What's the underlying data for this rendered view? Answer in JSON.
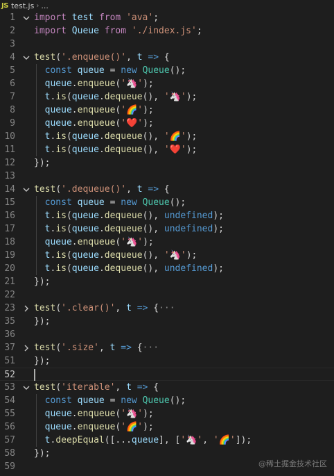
{
  "breadcrumb": {
    "lang_badge": "JS",
    "file": "test.js",
    "separator": "›",
    "more": "..."
  },
  "colors": {
    "background": "#1e1e1e",
    "keyword": "#c586c0",
    "builtin": "#569cd6",
    "string": "#ce9178",
    "function": "#dcdcaa",
    "variable": "#9cdcfe",
    "class": "#4ec9b0",
    "line_number": "#858585"
  },
  "lines": [
    {
      "n": "1",
      "fold": "open",
      "tokens": [
        [
          "kw",
          "import"
        ],
        [
          "pl",
          " "
        ],
        [
          "var",
          "test"
        ],
        [
          "pl",
          " "
        ],
        [
          "kw",
          "from"
        ],
        [
          "pl",
          " "
        ],
        [
          "str",
          "'ava'"
        ],
        [
          "pl",
          ";"
        ]
      ]
    },
    {
      "n": "2",
      "tokens": [
        [
          "kw",
          "import"
        ],
        [
          "pl",
          " "
        ],
        [
          "var",
          "Queue"
        ],
        [
          "pl",
          " "
        ],
        [
          "kw",
          "from"
        ],
        [
          "pl",
          " "
        ],
        [
          "str",
          "'./index.js'"
        ],
        [
          "pl",
          ";"
        ]
      ]
    },
    {
      "n": "3",
      "tokens": []
    },
    {
      "n": "4",
      "fold": "open",
      "tokens": [
        [
          "fn",
          "test"
        ],
        [
          "pl",
          "("
        ],
        [
          "str",
          "'.enqueue()'"
        ],
        [
          "pl",
          ", "
        ],
        [
          "var",
          "t"
        ],
        [
          "pl",
          " "
        ],
        [
          "kwb",
          "=>"
        ],
        [
          "pl",
          " {"
        ]
      ]
    },
    {
      "n": "5",
      "guide": true,
      "tokens": [
        [
          "pl",
          "  "
        ],
        [
          "kwb",
          "const"
        ],
        [
          "pl",
          " "
        ],
        [
          "var",
          "queue"
        ],
        [
          "pl",
          " = "
        ],
        [
          "kwb",
          "new"
        ],
        [
          "pl",
          " "
        ],
        [
          "cls",
          "Queue"
        ],
        [
          "pl",
          "();"
        ]
      ]
    },
    {
      "n": "6",
      "guide": true,
      "tokens": [
        [
          "pl",
          "  "
        ],
        [
          "var",
          "queue"
        ],
        [
          "pl",
          "."
        ],
        [
          "fn",
          "enqueue"
        ],
        [
          "pl",
          "("
        ],
        [
          "str",
          "'🦄'"
        ],
        [
          "pl",
          ");"
        ]
      ]
    },
    {
      "n": "7",
      "guide": true,
      "tokens": [
        [
          "pl",
          "  "
        ],
        [
          "var",
          "t"
        ],
        [
          "pl",
          "."
        ],
        [
          "fn",
          "is"
        ],
        [
          "pl",
          "("
        ],
        [
          "var",
          "queue"
        ],
        [
          "pl",
          "."
        ],
        [
          "fn",
          "dequeue"
        ],
        [
          "pl",
          "(), "
        ],
        [
          "str",
          "'🦄'"
        ],
        [
          "pl",
          ");"
        ]
      ]
    },
    {
      "n": "8",
      "guide": true,
      "tokens": [
        [
          "pl",
          "  "
        ],
        [
          "var",
          "queue"
        ],
        [
          "pl",
          "."
        ],
        [
          "fn",
          "enqueue"
        ],
        [
          "pl",
          "("
        ],
        [
          "str",
          "'🌈'"
        ],
        [
          "pl",
          ");"
        ]
      ]
    },
    {
      "n": "9",
      "guide": true,
      "tokens": [
        [
          "pl",
          "  "
        ],
        [
          "var",
          "queue"
        ],
        [
          "pl",
          "."
        ],
        [
          "fn",
          "enqueue"
        ],
        [
          "pl",
          "("
        ],
        [
          "str",
          "'❤️'"
        ],
        [
          "pl",
          ");"
        ]
      ]
    },
    {
      "n": "10",
      "guide": true,
      "tokens": [
        [
          "pl",
          "  "
        ],
        [
          "var",
          "t"
        ],
        [
          "pl",
          "."
        ],
        [
          "fn",
          "is"
        ],
        [
          "pl",
          "("
        ],
        [
          "var",
          "queue"
        ],
        [
          "pl",
          "."
        ],
        [
          "fn",
          "dequeue"
        ],
        [
          "pl",
          "(), "
        ],
        [
          "str",
          "'🌈'"
        ],
        [
          "pl",
          ");"
        ]
      ]
    },
    {
      "n": "11",
      "guide": true,
      "tokens": [
        [
          "pl",
          "  "
        ],
        [
          "var",
          "t"
        ],
        [
          "pl",
          "."
        ],
        [
          "fn",
          "is"
        ],
        [
          "pl",
          "("
        ],
        [
          "var",
          "queue"
        ],
        [
          "pl",
          "."
        ],
        [
          "fn",
          "dequeue"
        ],
        [
          "pl",
          "(), "
        ],
        [
          "str",
          "'❤️'"
        ],
        [
          "pl",
          ");"
        ]
      ]
    },
    {
      "n": "12",
      "tokens": [
        [
          "pl",
          "});"
        ]
      ]
    },
    {
      "n": "13",
      "tokens": []
    },
    {
      "n": "14",
      "fold": "open",
      "tokens": [
        [
          "fn",
          "test"
        ],
        [
          "pl",
          "("
        ],
        [
          "str",
          "'.dequeue()'"
        ],
        [
          "pl",
          ", "
        ],
        [
          "var",
          "t"
        ],
        [
          "pl",
          " "
        ],
        [
          "kwb",
          "=>"
        ],
        [
          "pl",
          " {"
        ]
      ]
    },
    {
      "n": "15",
      "guide": true,
      "tokens": [
        [
          "pl",
          "  "
        ],
        [
          "kwb",
          "const"
        ],
        [
          "pl",
          " "
        ],
        [
          "var",
          "queue"
        ],
        [
          "pl",
          " = "
        ],
        [
          "kwb",
          "new"
        ],
        [
          "pl",
          " "
        ],
        [
          "cls",
          "Queue"
        ],
        [
          "pl",
          "();"
        ]
      ]
    },
    {
      "n": "16",
      "guide": true,
      "tokens": [
        [
          "pl",
          "  "
        ],
        [
          "var",
          "t"
        ],
        [
          "pl",
          "."
        ],
        [
          "fn",
          "is"
        ],
        [
          "pl",
          "("
        ],
        [
          "var",
          "queue"
        ],
        [
          "pl",
          "."
        ],
        [
          "fn",
          "dequeue"
        ],
        [
          "pl",
          "(), "
        ],
        [
          "kwb",
          "undefined"
        ],
        [
          "pl",
          ");"
        ]
      ]
    },
    {
      "n": "17",
      "guide": true,
      "tokens": [
        [
          "pl",
          "  "
        ],
        [
          "var",
          "t"
        ],
        [
          "pl",
          "."
        ],
        [
          "fn",
          "is"
        ],
        [
          "pl",
          "("
        ],
        [
          "var",
          "queue"
        ],
        [
          "pl",
          "."
        ],
        [
          "fn",
          "dequeue"
        ],
        [
          "pl",
          "(), "
        ],
        [
          "kwb",
          "undefined"
        ],
        [
          "pl",
          ");"
        ]
      ]
    },
    {
      "n": "18",
      "guide": true,
      "tokens": [
        [
          "pl",
          "  "
        ],
        [
          "var",
          "queue"
        ],
        [
          "pl",
          "."
        ],
        [
          "fn",
          "enqueue"
        ],
        [
          "pl",
          "("
        ],
        [
          "str",
          "'🦄'"
        ],
        [
          "pl",
          ");"
        ]
      ]
    },
    {
      "n": "19",
      "guide": true,
      "tokens": [
        [
          "pl",
          "  "
        ],
        [
          "var",
          "t"
        ],
        [
          "pl",
          "."
        ],
        [
          "fn",
          "is"
        ],
        [
          "pl",
          "("
        ],
        [
          "var",
          "queue"
        ],
        [
          "pl",
          "."
        ],
        [
          "fn",
          "dequeue"
        ],
        [
          "pl",
          "(), "
        ],
        [
          "str",
          "'🦄'"
        ],
        [
          "pl",
          ");"
        ]
      ]
    },
    {
      "n": "20",
      "guide": true,
      "tokens": [
        [
          "pl",
          "  "
        ],
        [
          "var",
          "t"
        ],
        [
          "pl",
          "."
        ],
        [
          "fn",
          "is"
        ],
        [
          "pl",
          "("
        ],
        [
          "var",
          "queue"
        ],
        [
          "pl",
          "."
        ],
        [
          "fn",
          "dequeue"
        ],
        [
          "pl",
          "(), "
        ],
        [
          "kwb",
          "undefined"
        ],
        [
          "pl",
          ");"
        ]
      ]
    },
    {
      "n": "21",
      "tokens": [
        [
          "pl",
          "});"
        ]
      ]
    },
    {
      "n": "22",
      "tokens": []
    },
    {
      "n": "23",
      "fold": "closed",
      "tokens": [
        [
          "fn",
          "test"
        ],
        [
          "pl",
          "("
        ],
        [
          "str",
          "'.clear()'"
        ],
        [
          "pl",
          ", "
        ],
        [
          "var",
          "t"
        ],
        [
          "pl",
          " "
        ],
        [
          "kwb",
          "=>"
        ],
        [
          "pl",
          " {"
        ],
        [
          "ell",
          "···"
        ]
      ]
    },
    {
      "n": "35",
      "tokens": [
        [
          "pl",
          "});"
        ]
      ]
    },
    {
      "n": "36",
      "tokens": []
    },
    {
      "n": "37",
      "fold": "closed",
      "tokens": [
        [
          "fn",
          "test"
        ],
        [
          "pl",
          "("
        ],
        [
          "str",
          "'.size'"
        ],
        [
          "pl",
          ", "
        ],
        [
          "var",
          "t"
        ],
        [
          "pl",
          " "
        ],
        [
          "kwb",
          "=>"
        ],
        [
          "pl",
          " {"
        ],
        [
          "ell",
          "···"
        ]
      ]
    },
    {
      "n": "51",
      "tokens": [
        [
          "pl",
          "});"
        ]
      ]
    },
    {
      "n": "52",
      "active": true,
      "caret": true,
      "tokens": []
    },
    {
      "n": "53",
      "fold": "open",
      "tokens": [
        [
          "fn",
          "test"
        ],
        [
          "pl",
          "("
        ],
        [
          "str",
          "'iterable'"
        ],
        [
          "pl",
          ", "
        ],
        [
          "var",
          "t"
        ],
        [
          "pl",
          " "
        ],
        [
          "kwb",
          "=>"
        ],
        [
          "pl",
          " {"
        ]
      ]
    },
    {
      "n": "54",
      "guide": true,
      "tokens": [
        [
          "pl",
          "  "
        ],
        [
          "kwb",
          "const"
        ],
        [
          "pl",
          " "
        ],
        [
          "var",
          "queue"
        ],
        [
          "pl",
          " = "
        ],
        [
          "kwb",
          "new"
        ],
        [
          "pl",
          " "
        ],
        [
          "cls",
          "Queue"
        ],
        [
          "pl",
          "();"
        ]
      ]
    },
    {
      "n": "55",
      "guide": true,
      "tokens": [
        [
          "pl",
          "  "
        ],
        [
          "var",
          "queue"
        ],
        [
          "pl",
          "."
        ],
        [
          "fn",
          "enqueue"
        ],
        [
          "pl",
          "("
        ],
        [
          "str",
          "'🦄'"
        ],
        [
          "pl",
          ");"
        ]
      ]
    },
    {
      "n": "56",
      "guide": true,
      "tokens": [
        [
          "pl",
          "  "
        ],
        [
          "var",
          "queue"
        ],
        [
          "pl",
          "."
        ],
        [
          "fn",
          "enqueue"
        ],
        [
          "pl",
          "("
        ],
        [
          "str",
          "'🌈'"
        ],
        [
          "pl",
          ");"
        ]
      ]
    },
    {
      "n": "57",
      "guide": true,
      "tokens": [
        [
          "pl",
          "  "
        ],
        [
          "var",
          "t"
        ],
        [
          "pl",
          "."
        ],
        [
          "fn",
          "deepEqual"
        ],
        [
          "pl",
          "([..."
        ],
        [
          "var",
          "queue"
        ],
        [
          "pl",
          "], ["
        ],
        [
          "str",
          "'🦄'"
        ],
        [
          "pl",
          ", "
        ],
        [
          "str",
          "'🌈'"
        ],
        [
          "pl",
          "]);"
        ]
      ]
    },
    {
      "n": "58",
      "tokens": [
        [
          "pl",
          "});"
        ]
      ]
    },
    {
      "n": "59",
      "tokens": []
    }
  ],
  "watermark": "@稀土掘金技术社区"
}
